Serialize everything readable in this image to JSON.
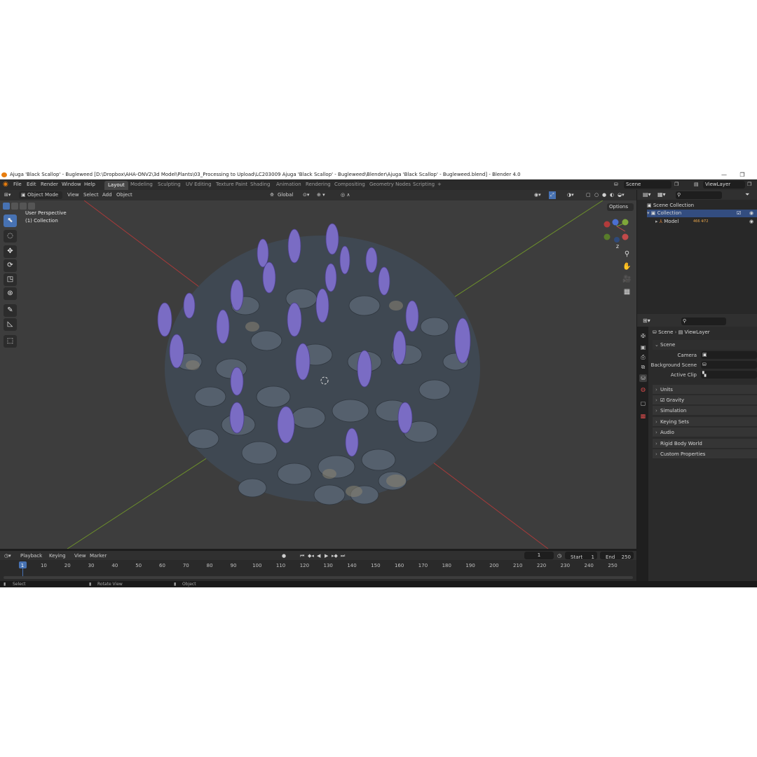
{
  "window": {
    "title": "Ajuga 'Black Scallop' - Bugleweed [D:\\Dropbox\\AHA-ONV2\\3d Model\\Plants\\03_Processing to Upload\\LC203009 Ajuga 'Black Scallop' - Bugleweed\\Blender\\Ajuga 'Black Scallop' - Bugleweed.blend] - Blender 4.0",
    "minimize": "—",
    "restore": "❐"
  },
  "menu": [
    "File",
    "Edit",
    "Render",
    "Window",
    "Help"
  ],
  "workspaces": [
    "Layout",
    "Modeling",
    "Sculpting",
    "UV Editing",
    "Texture Paint",
    "Shading",
    "Animation",
    "Rendering",
    "Compositing",
    "Geometry Nodes",
    "Scripting"
  ],
  "add_workspace": "+",
  "scene_field": "Scene",
  "viewlayer_field": "ViewLayer",
  "viewport_header": {
    "mode": "Object Mode",
    "menus": [
      "View",
      "Select",
      "Add",
      "Object"
    ],
    "orientation": "Global",
    "options_label": "Options"
  },
  "viewport": {
    "perspective_label": "User Perspective",
    "collection_label": "(1) Collection",
    "gizmo_axes": [
      "Z",
      "Y",
      "X"
    ]
  },
  "outliner": {
    "scene_collection": "Scene Collection",
    "collection": "Collection",
    "model": "Model",
    "model_badge": "466 4⁄72"
  },
  "properties": {
    "breadcrumb_scene": "Scene",
    "breadcrumb_viewlayer": "ViewLayer",
    "panel_title": "Scene",
    "camera_label": "Camera",
    "background_label": "Background Scene",
    "active_clip_label": "Active Clip",
    "sections": [
      "Units",
      "Gravity",
      "Simulation",
      "Keying Sets",
      "Audio",
      "Rigid Body World",
      "Custom Properties"
    ]
  },
  "timeline": {
    "menus": [
      "Playback",
      "Keying",
      "View",
      "Marker"
    ],
    "current_frame": "1",
    "start_label": "Start",
    "start_value": "1",
    "end_label": "End",
    "end_value": "250",
    "ticks": [
      "1",
      "10",
      "20",
      "30",
      "40",
      "50",
      "60",
      "70",
      "80",
      "90",
      "100",
      "110",
      "120",
      "130",
      "140",
      "150",
      "160",
      "170",
      "180",
      "190",
      "200",
      "210",
      "220",
      "230",
      "240",
      "250"
    ]
  },
  "statusbar": {
    "select": "Select",
    "rotate": "Rotate View",
    "object": "Object"
  },
  "colors": {
    "accent": "#4772b3",
    "viewport_bg": "#3d3d3d",
    "axis_x": "#a83a3a",
    "axis_y": "#6c8f2b",
    "flower": "#7a6cc4",
    "leaf": "#4f5b68"
  }
}
